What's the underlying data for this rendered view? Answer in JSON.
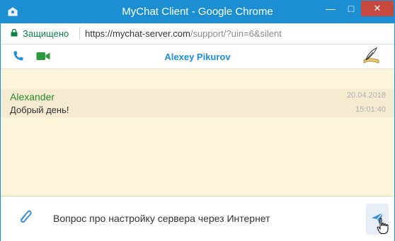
{
  "window": {
    "title": "MyChat Client - Google Chrome",
    "controls": {
      "minimize": "—",
      "maximize": "□",
      "close": "✕"
    }
  },
  "address_bar": {
    "secure_label": "Защищено",
    "url_host": "https://mychat-server.com",
    "url_path": "/support/?uin=6&silent"
  },
  "chat_header": {
    "contact_name": "Alexey Pikurov",
    "icons": [
      "phone-icon",
      "video-camera-icon",
      "quill-scroll-icon"
    ]
  },
  "messages": [
    {
      "author": "Alexander",
      "text": "Добрый день!",
      "date": "20.04.2018",
      "time": "15:01:40"
    }
  ],
  "composer": {
    "value": "Вопрос про настройку сервера через Интернет",
    "icons": [
      "paperclip-icon",
      "send-icon"
    ]
  },
  "colors": {
    "titlebar": "#1c8fd3",
    "accent": "#1a8fd8",
    "author": "#2c8a2c",
    "chat_background": "#fdf5d9",
    "close_button": "#c7483d"
  }
}
